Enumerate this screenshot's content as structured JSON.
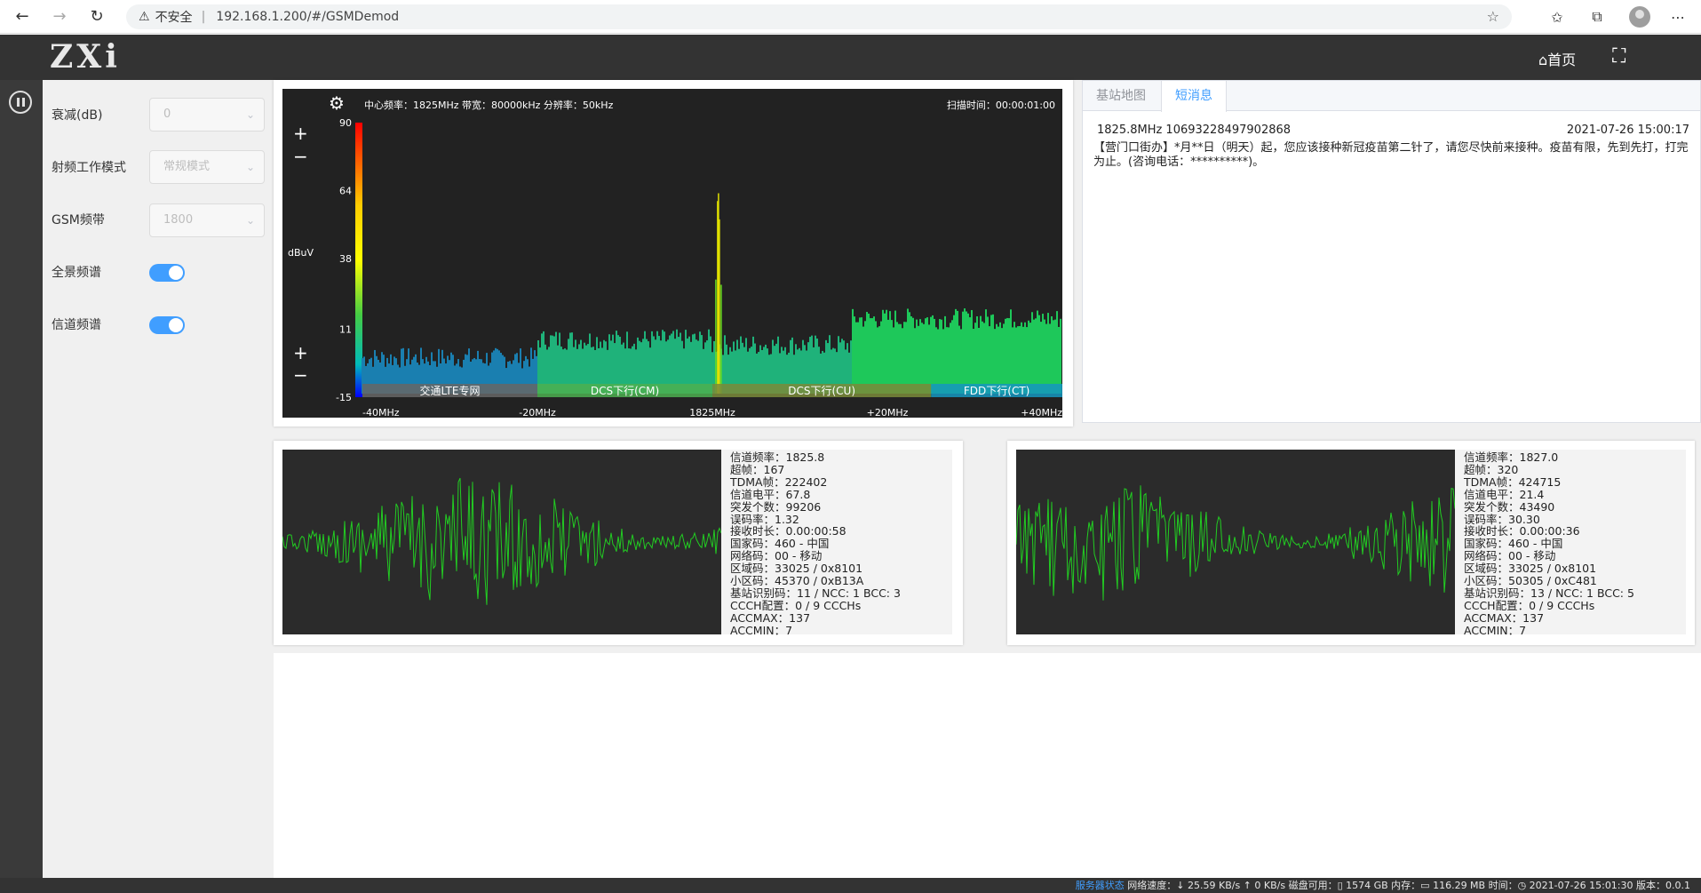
{
  "browser": {
    "back": "←",
    "forward": "→",
    "reload": "↻",
    "warning": "⚠",
    "insecure_label": "不安全",
    "separator": "|",
    "url": "192.168.1.200/#/GSMDemod"
  },
  "header": {
    "logo": "ZXi",
    "home_label": "⌂首页",
    "fullscreen_icon": "⛶"
  },
  "settings": {
    "attenuation": {
      "label": "衰减(dB)",
      "value": "0"
    },
    "rf_mode": {
      "label": "射频工作模式",
      "value": "常规模式"
    },
    "gsm_band": {
      "label": "GSM频带",
      "value": "1800"
    },
    "panorama": {
      "label": "全景频谱",
      "on": true
    },
    "channel_spectrum": {
      "label": "信道频谱",
      "on": true
    }
  },
  "spectrum": {
    "header_left": "中心频率：1825MHz 带宽：80000kHz 分辨率：50kHz",
    "header_right": "扫描时间：00:00:01:00",
    "unit": "dBuV",
    "y_ticks": [
      "90",
      "64",
      "38",
      "11",
      "-15"
    ],
    "y_min": -15,
    "y_max": 90,
    "x_ticks": [
      "-40MHz",
      "-20MHz",
      "1825MHz",
      "+20MHz",
      "+40MHz"
    ],
    "bands": [
      {
        "label": "交通LTE专网",
        "start": -40,
        "end": -20,
        "color": "#666666"
      },
      {
        "label": "DCS下行(CM)",
        "start": -20,
        "end": 0,
        "color": "#4caf50"
      },
      {
        "label": "DCS下行(CU)",
        "start": 0,
        "end": 25,
        "color": "#7a8a3a"
      },
      {
        "label": "FDD下行(CT)",
        "start": 25,
        "end": 40,
        "color": "#1597c0"
      }
    ],
    "levels": [
      {
        "from": -40,
        "to": -20,
        "level": -2
      },
      {
        "from": -20,
        "to": 0,
        "level": 5
      },
      {
        "from": 0,
        "to": 16,
        "level": 3
      },
      {
        "from": 16,
        "to": 40,
        "level": 13
      }
    ],
    "peaks": [
      {
        "freq": 0.7,
        "level": 63
      }
    ]
  },
  "tabs": {
    "items": [
      {
        "label": "基站地图",
        "active": false
      },
      {
        "label": "短消息",
        "active": true
      }
    ],
    "message": {
      "freq_id": "1825.8MHz 10693228497902868",
      "time": "2021-07-26 15:00:17",
      "body": "【营门口街办】*月**日（明天）起，您应该接种新冠疫苗第二针了，请您尽快前来接种。疫苗有限，先到先打，打完为止。(咨询电话：**********)。"
    }
  },
  "channels": [
    {
      "lines": [
        "信道频率：1825.8",
        "超帧：167",
        "TDMA帧：222402",
        "信道电平：67.8",
        "突发个数：99206",
        "误码率：1.32",
        "接收时长：0.00:00:58",
        "国家码：460 - 中国",
        "网络码：00 - 移动",
        "区域码：33025 / 0x8101",
        "小区码：45370 / 0xB13A",
        "基站识别码：11 / NCC: 1 BCC: 3",
        "CCCH配置：0 / 9 CCCHs",
        "ACCMAX：137",
        "ACCMIN：7"
      ]
    },
    {
      "lines": [
        "信道频率：1827.0",
        "超帧：320",
        "TDMA帧：424715",
        "信道电平：21.4",
        "突发个数：43490",
        "误码率：30.30",
        "接收时长：0.00:00:36",
        "国家码：460 - 中国",
        "网络码：00 - 移动",
        "区域码：33025 / 0x8101",
        "小区码：50305 / 0xC481",
        "基站识别码：13 / NCC: 1 BCC: 5",
        "CCCH配置：0 / 9 CCCHs",
        "ACCMAX：137",
        "ACCMIN：7"
      ]
    }
  ],
  "status": {
    "link": "服务器状态",
    "text": "网络速度：↓ 25.59 KB/s ↑ 0 KB/s 磁盘可用：▯ 1574 GB 内存：▭ 116.29 MB 时间：◷ 2021-07-26 15:01:30 版本：0.0.1"
  },
  "colors": {
    "header_bg": "#333333",
    "accent": "#409eff",
    "wave": "#22cc22",
    "spectrum_bg": "#222222"
  }
}
